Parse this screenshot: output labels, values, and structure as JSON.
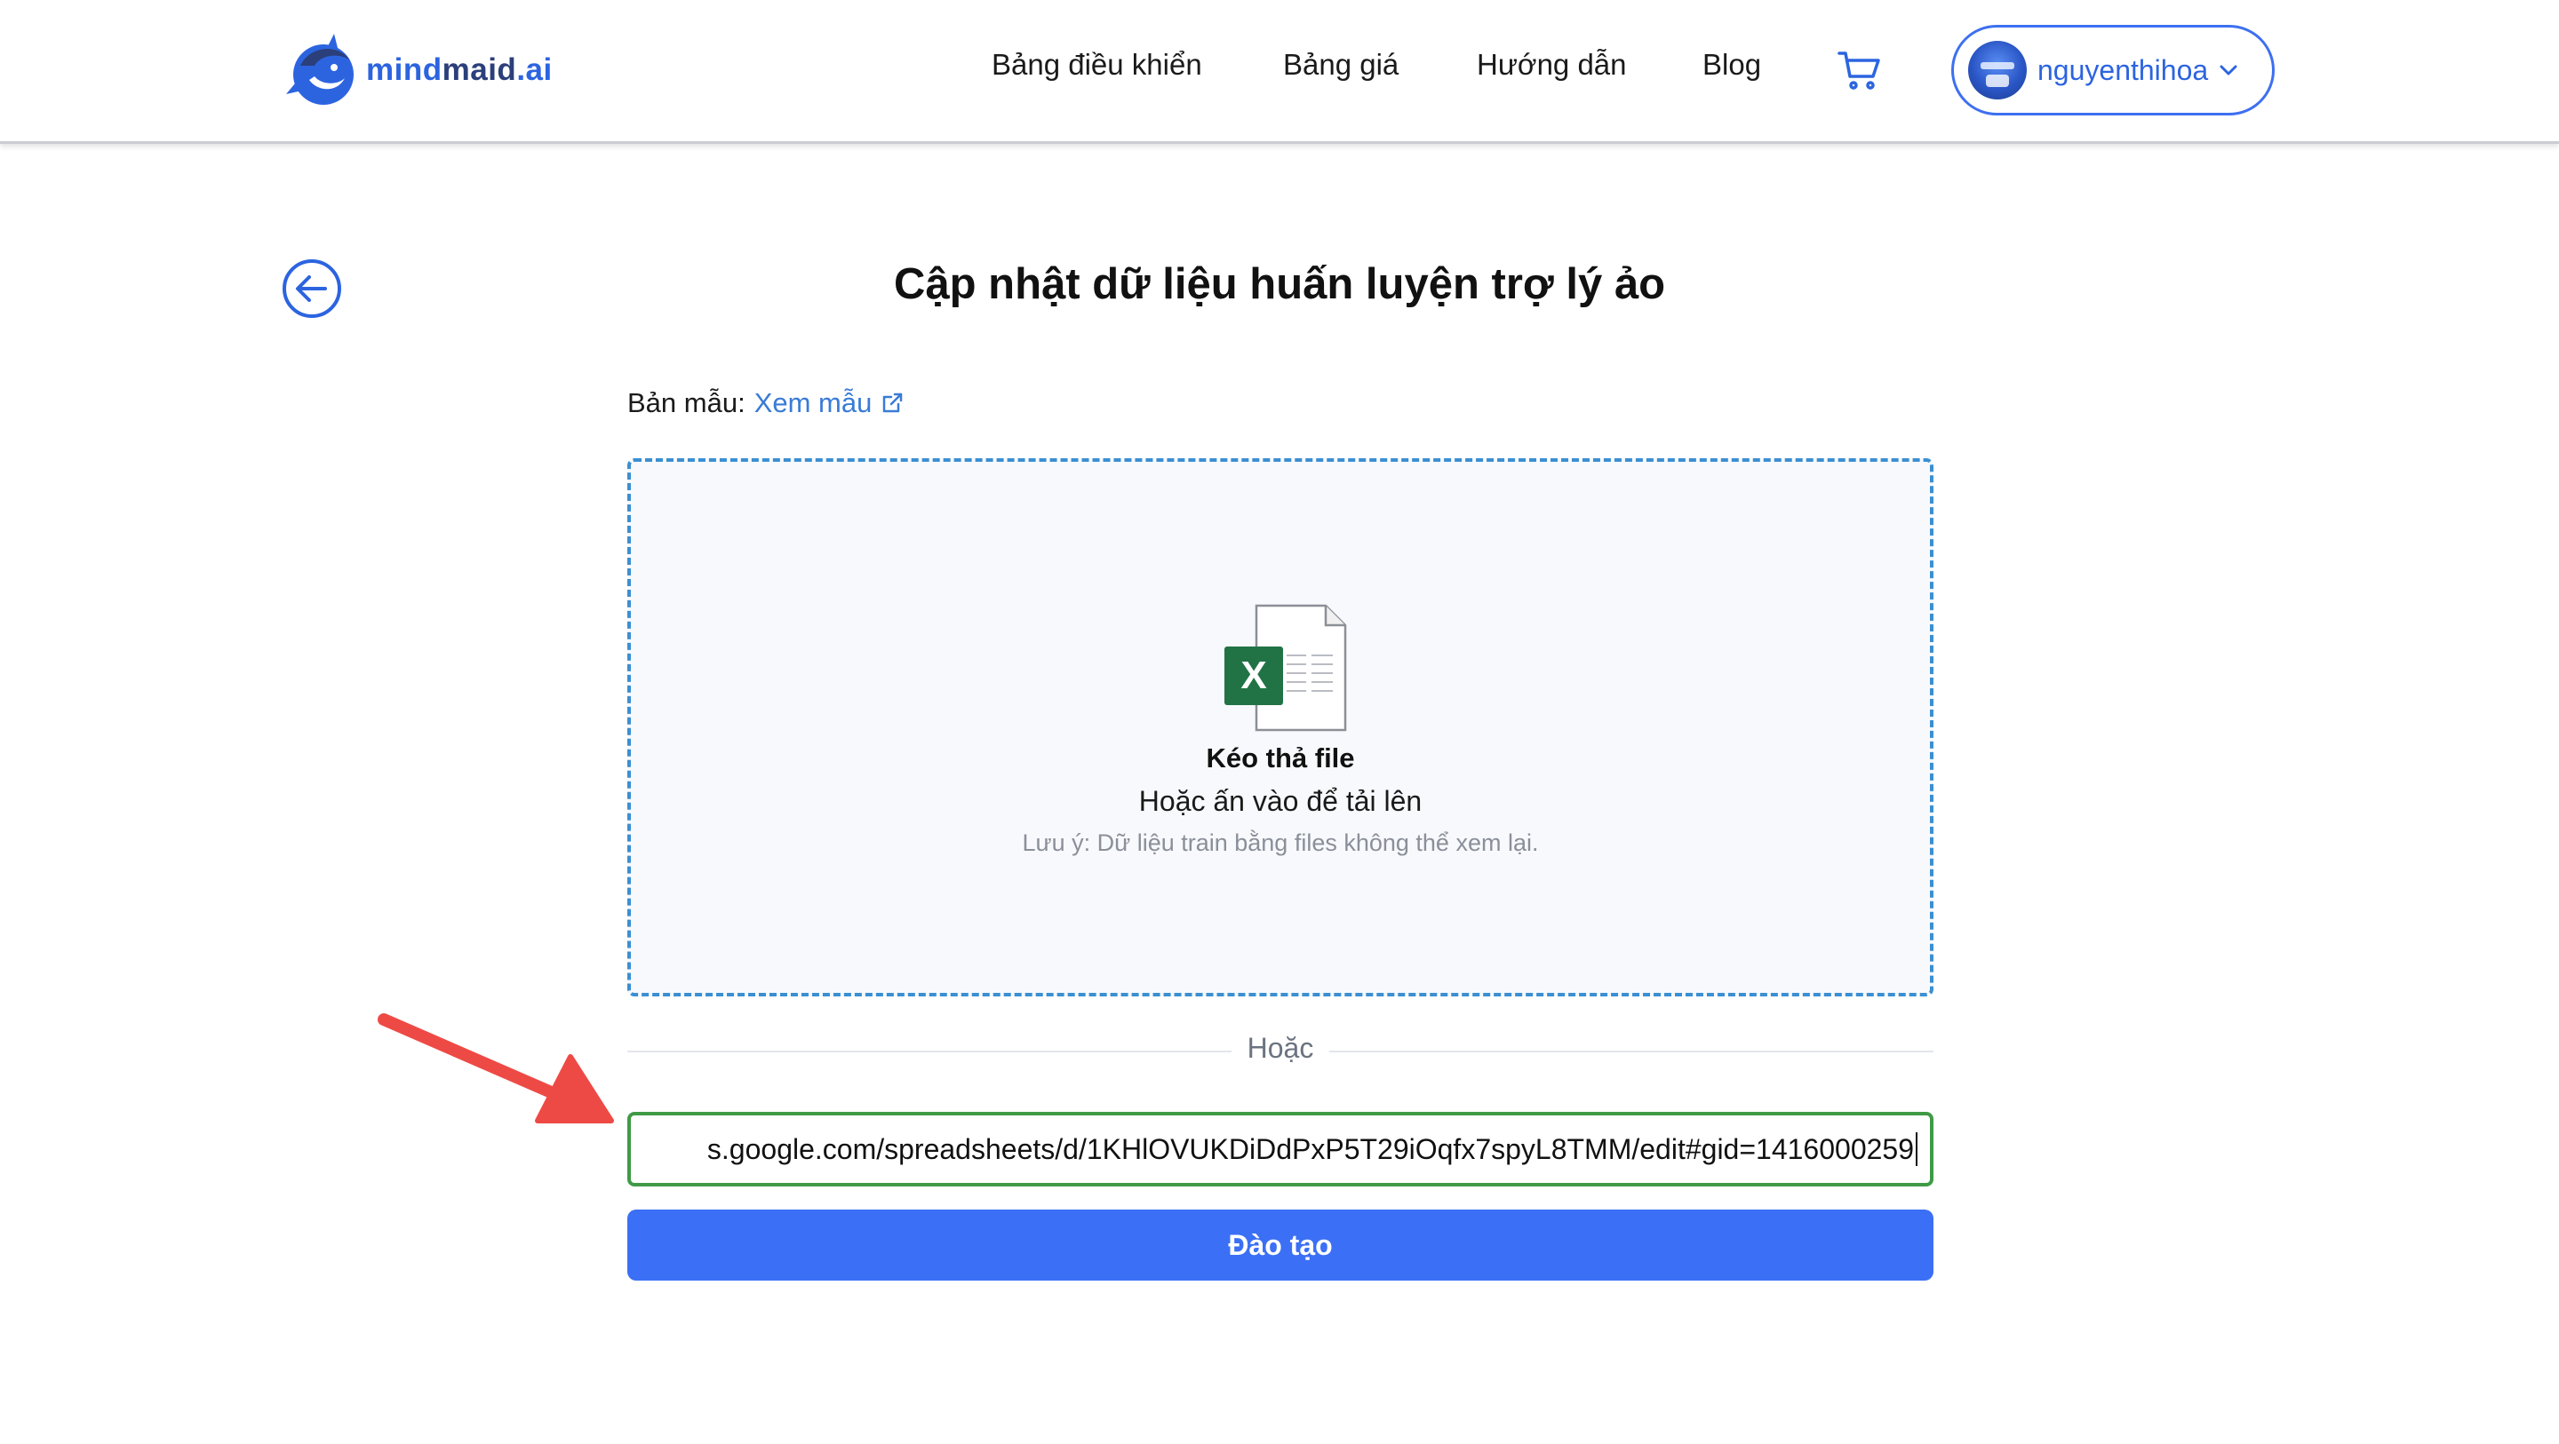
{
  "header": {
    "logo": {
      "part1": "mind",
      "part2": "maid",
      "part3": ".ai"
    },
    "nav": [
      {
        "label": "Bảng điều khiển"
      },
      {
        "label": "Bảng giá"
      },
      {
        "label": "Hướng dẫn"
      },
      {
        "label": "Blog"
      }
    ],
    "cart_icon": "shopping-cart-icon",
    "user": {
      "name": "nguyenthihoa"
    }
  },
  "page": {
    "title": "Cập nhật dữ liệu huấn luyện trợ lý ảo",
    "template_label": "Bản mẫu:",
    "template_link": "Xem mẫu"
  },
  "dropzone": {
    "icon": "excel-file-icon",
    "icon_letter": "X",
    "title": "Kéo thả file",
    "subtitle": "Hoặc ấn vào để tải lên",
    "note": "Lưu ý: Dữ liệu train bằng files không thể xem lại."
  },
  "divider_text": "Hoặc",
  "url_input": {
    "value": "s.google.com/spreadsheets/d/1KHlOVUKDiDdPxP5T29iOqfx7spyL8TMM/edit#gid=1416000259"
  },
  "train_button": "Đào tạo",
  "colors": {
    "accent": "#3b6ff5",
    "brand_dark": "#2b3f7a",
    "input_border": "#3f9a46",
    "dropzone_border": "#3b8fd2",
    "annotation_arrow": "#ee4a45"
  }
}
